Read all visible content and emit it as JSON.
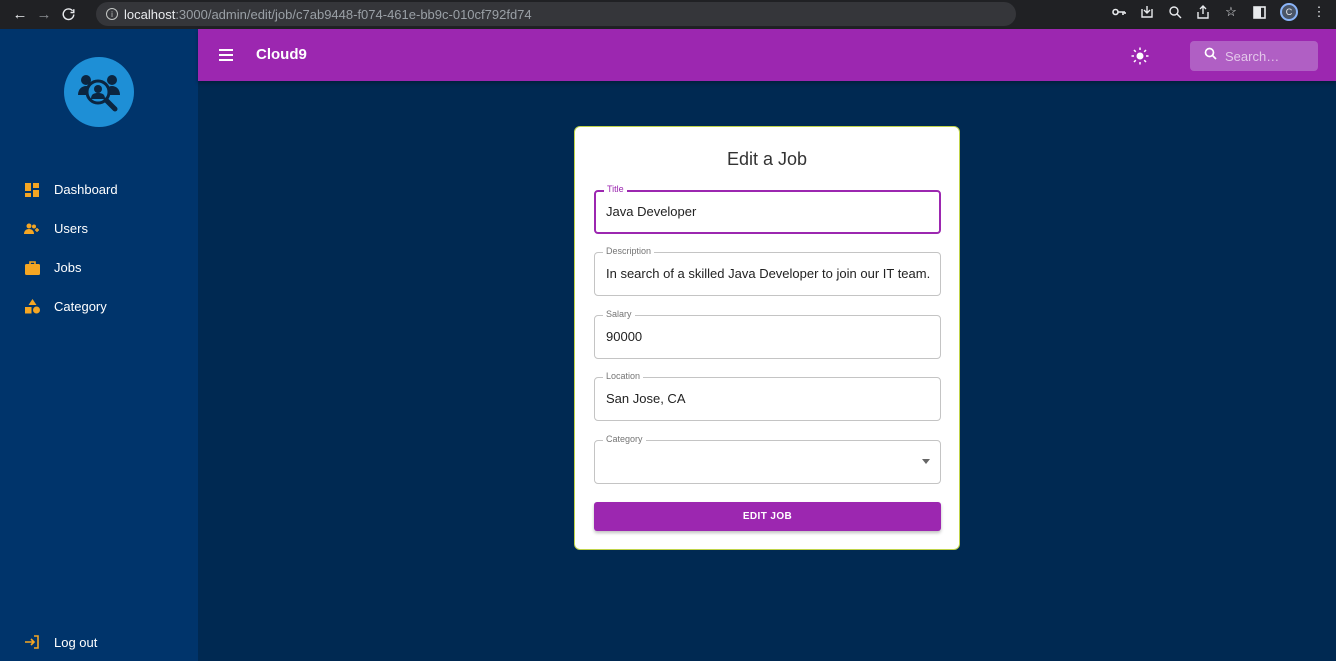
{
  "browser": {
    "url_host": "localhost",
    "url_path": ":3000/admin/edit/job/c7ab9448-f074-461e-bb9c-010cf792fd74",
    "profile_initial": "C"
  },
  "sidebar": {
    "items": [
      {
        "label": "Dashboard",
        "icon": "dashboard-icon"
      },
      {
        "label": "Users",
        "icon": "users-icon"
      },
      {
        "label": "Jobs",
        "icon": "briefcase-icon"
      },
      {
        "label": "Category",
        "icon": "category-icon"
      }
    ],
    "logout_label": "Log out"
  },
  "appbar": {
    "title": "Cloud9",
    "search_placeholder": "Search…"
  },
  "form": {
    "title": "Edit a Job",
    "fields": {
      "title": {
        "label": "Title",
        "value": "Java Developer"
      },
      "description": {
        "label": "Description",
        "value": "In search of a skilled Java Developer to join our IT team. T"
      },
      "salary": {
        "label": "Salary",
        "value": "90000"
      },
      "location": {
        "label": "Location",
        "value": "San Jose, CA"
      },
      "category": {
        "label": "Category",
        "value": ""
      }
    },
    "submit_label": "EDIT JOB"
  },
  "colors": {
    "appbar": "#9c27b0",
    "sidebar": "#00346b",
    "background": "#002952",
    "icon_accent": "#f5a623",
    "logo": "#1e8fd6"
  }
}
